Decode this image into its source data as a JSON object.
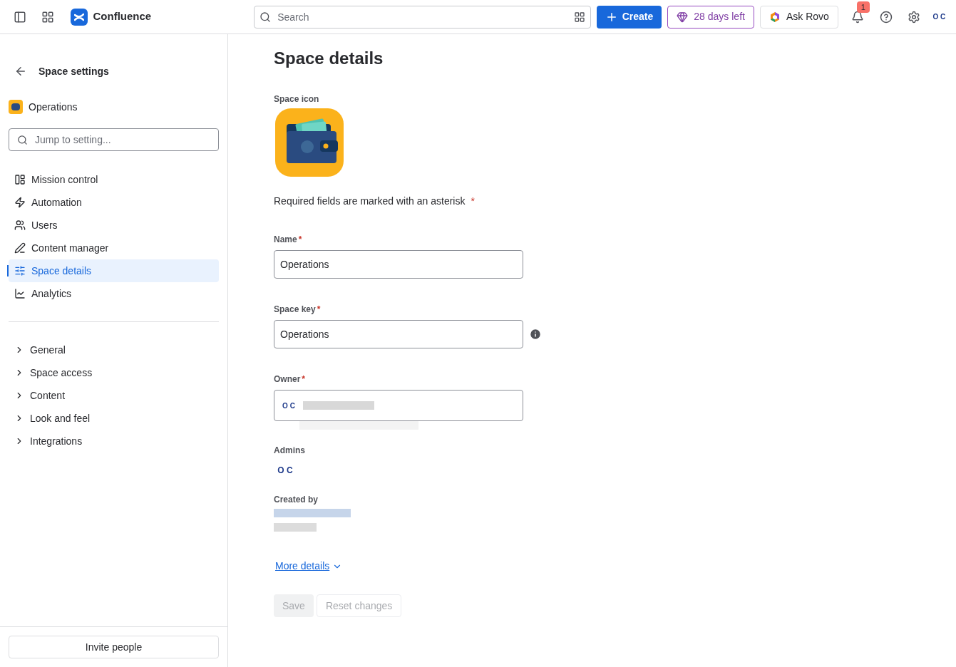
{
  "topbar": {
    "app_name": "Confluence",
    "search": {
      "placeholder": "Search"
    },
    "create": "Create",
    "trial": "28 days left",
    "ask": "Ask Rovo",
    "notifications": "1",
    "avatar": "O C"
  },
  "sidebar": {
    "back": "Space settings",
    "space": "Operations",
    "search": {
      "placeholder": "Jump to setting..."
    },
    "items": [
      {
        "label": "Mission control",
        "selected": false
      },
      {
        "label": "Automation",
        "selected": false
      },
      {
        "label": "Users",
        "selected": false
      },
      {
        "label": "Content manager",
        "selected": false
      },
      {
        "label": "Space details",
        "selected": true
      },
      {
        "label": "Analytics",
        "selected": false
      }
    ],
    "sections": [
      {
        "label": "General",
        "expanded": false
      },
      {
        "label": "Space access",
        "expanded": false
      },
      {
        "label": "Content",
        "expanded": false
      },
      {
        "label": "Look and feel",
        "expanded": false
      },
      {
        "label": "Integrations",
        "expanded": false
      }
    ],
    "invite": "Invite people"
  },
  "main": {
    "title": "Space details",
    "icon_label": "Space icon",
    "required_note": "Required fields are marked with an asterisk",
    "asterisk": "*",
    "fields": [
      {
        "label": "Name",
        "required": true,
        "value": "Operations",
        "info": false
      },
      {
        "label": "Space key",
        "required": true,
        "value": "Operations",
        "info": true
      }
    ],
    "owner": {
      "label": "Owner",
      "required": true,
      "avatar": "O C"
    },
    "admins": {
      "label": "Admins",
      "avatar": "O C"
    },
    "created_by": {
      "label": "Created by"
    },
    "more": "More details",
    "buttons": [
      {
        "label": "Save",
        "disabled": true
      },
      {
        "label": "Reset changes",
        "disabled": true
      }
    ]
  }
}
